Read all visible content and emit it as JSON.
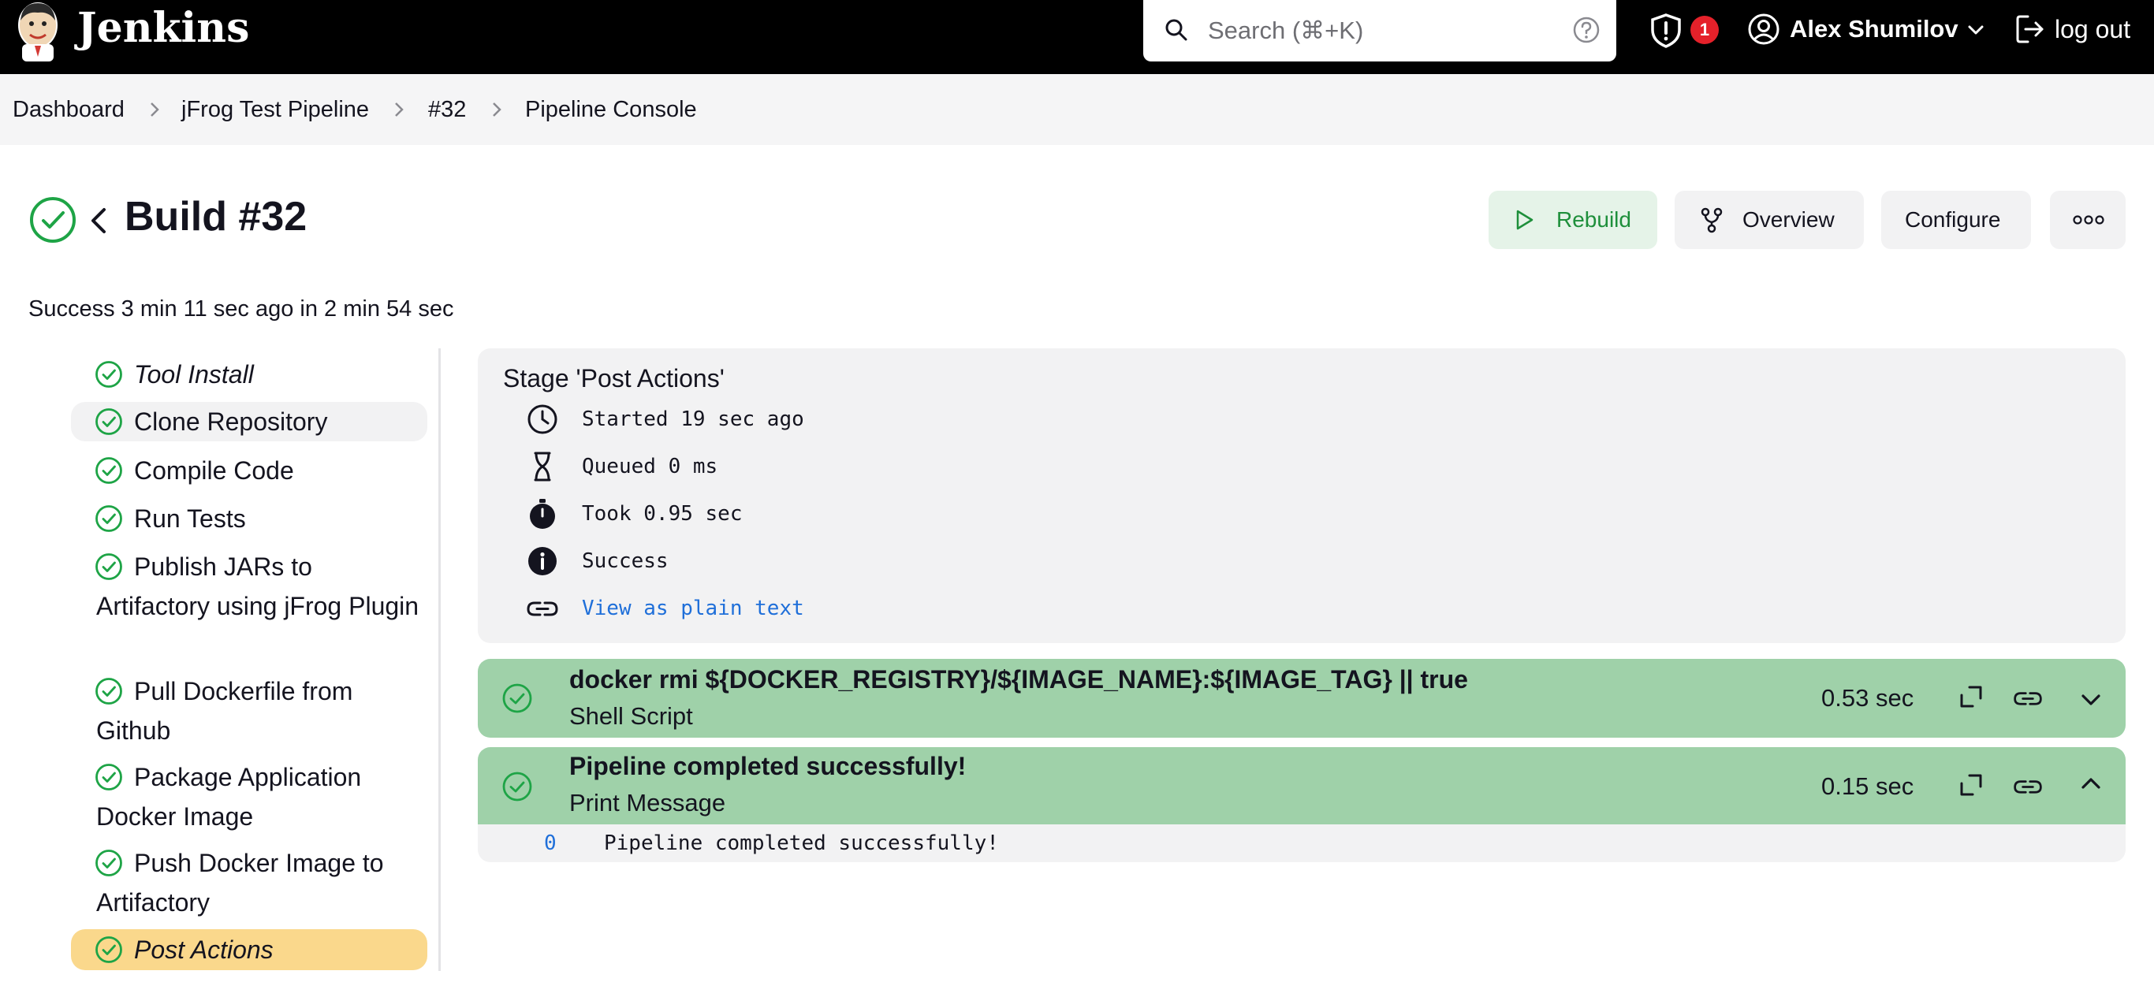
{
  "header": {
    "brand": "Jenkins",
    "search_placeholder": "Search (⌘+K)",
    "alert_count": "1",
    "user_name": "Alex Shumilov",
    "logout_label": "log out"
  },
  "breadcrumbs": [
    "Dashboard",
    "jFrog Test Pipeline",
    "#32",
    "Pipeline Console"
  ],
  "build": {
    "title": "Build #32",
    "summary": "Success 3 min 11 sec ago in 2 min 54 sec",
    "actions": {
      "rebuild": "Rebuild",
      "overview": "Overview",
      "configure": "Configure",
      "more": "more-actions"
    }
  },
  "stages": [
    {
      "label": "Tool Install",
      "status": "success"
    },
    {
      "label": "Clone Repository",
      "status": "success"
    },
    {
      "label": "Compile Code",
      "status": "success"
    },
    {
      "label": "Run Tests",
      "status": "success"
    },
    {
      "label": "Publish JARs to Artifactory using jFrog Plugin",
      "status": "success"
    },
    {
      "label": "Pull Dockerfile from Github",
      "status": "success"
    },
    {
      "label": "Package Application Docker Image",
      "status": "success"
    },
    {
      "label": "Push Docker Image to Artifactory",
      "status": "success"
    },
    {
      "label": "Post Actions",
      "status": "success",
      "selected": true
    }
  ],
  "stage_detail": {
    "title": "Stage 'Post Actions'",
    "started": "Started 19 sec ago",
    "queued": "Queued 0 ms",
    "took": "Took 0.95 sec",
    "result": "Success",
    "plain_text_link": "View as plain text"
  },
  "steps": [
    {
      "command": "docker rmi ${DOCKER_REGISTRY}/${IMAGE_NAME}:${IMAGE_TAG} || true",
      "type": "Shell Script",
      "duration": "0.53 sec",
      "expanded": false
    },
    {
      "command": "Pipeline completed successfully!",
      "type": "Print Message",
      "duration": "0.15 sec",
      "expanded": true,
      "log": [
        {
          "line": "0",
          "text": "Pipeline completed successfully!"
        }
      ]
    }
  ],
  "colors": {
    "success": "#1ea446",
    "step_bg": "#9fd1a9",
    "selected_stage": "#fad88c",
    "link": "#1f6fd9",
    "alert": "#e5212a"
  }
}
